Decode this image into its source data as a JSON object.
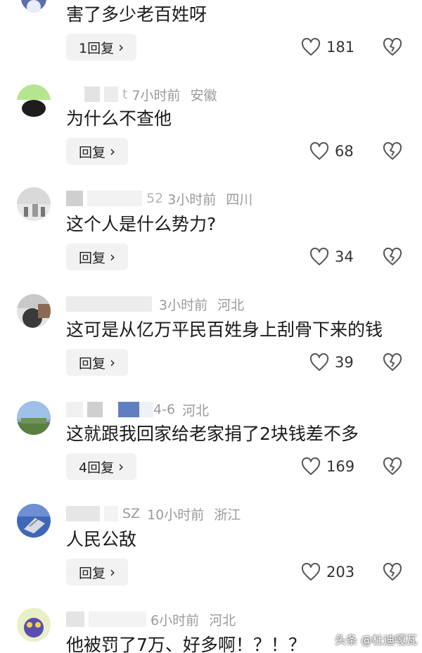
{
  "comments": [
    {
      "text": "害了多少老百姓呀",
      "reply_label": "1回复",
      "likes": "181"
    },
    {
      "name_fragment": "t",
      "time": "7小时前",
      "region": "安徽",
      "text": "为什么不查他",
      "reply_label": "回复",
      "likes": "68"
    },
    {
      "name_fragment": "52",
      "time": "3小时前",
      "region": "四川",
      "text": "这个人是什么势力?",
      "reply_label": "回复",
      "likes": "34"
    },
    {
      "time": "3小时前",
      "region": "河北",
      "text": "这可是从亿万平民百姓身上刮骨下来的钱",
      "reply_label": "回复",
      "likes": "39"
    },
    {
      "name_fragment": "4-6",
      "region": "河北",
      "text": "这就跟我回家给老家捐了2块钱差不多",
      "reply_label": "4回复",
      "likes": "169"
    },
    {
      "name_fragment": "SZ",
      "time": "10小时前",
      "region": "浙江",
      "text": "人民公敌",
      "reply_label": "回复",
      "likes": "203"
    },
    {
      "time": "6小时前",
      "region": "河北",
      "text": "他被罚了7万、好多啊！？！？"
    }
  ],
  "reply_chevron": "›",
  "watermark": "头条 @杜迪嘎瓦",
  "icons": {
    "like": "heart-outline-icon",
    "dislike": "broken-heart-icon"
  },
  "colors": {
    "text": "#1a1a1a",
    "meta": "#9a9a9a",
    "reply_bg": "#f2f2f2",
    "icon": "#555555"
  }
}
